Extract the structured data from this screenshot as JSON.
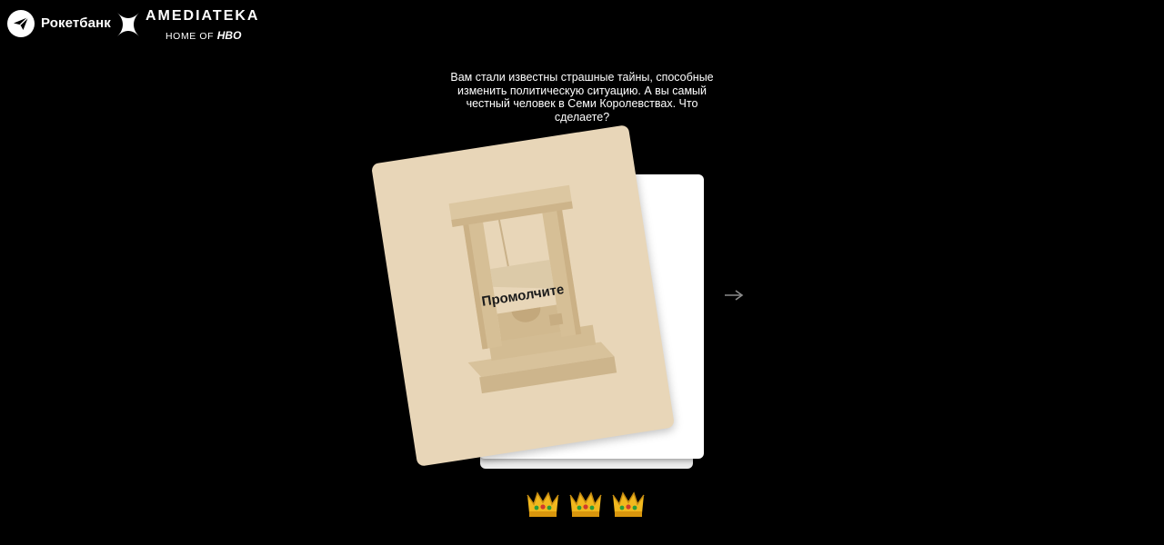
{
  "header": {
    "rocketbank_name": "Рокетбанк",
    "amediateka_name": "AMEDIATEKA",
    "amediateka_tagline_prefix": "HOME OF",
    "amediateka_tagline_brand": "HBO"
  },
  "question": {
    "text": "Вам стали известны страшные тайны, способные изменить политическую ситуацию. А вы самый честный человек в Семи Королевствах. Что сделаете?"
  },
  "card": {
    "answer_label": "Промолчите",
    "illustration_icon": "guillotine-icon",
    "background_color": "#e8d6b8"
  },
  "navigation": {
    "next_icon": "arrow-right-icon"
  },
  "lives": {
    "count": 3,
    "icon": "crown-icon"
  }
}
